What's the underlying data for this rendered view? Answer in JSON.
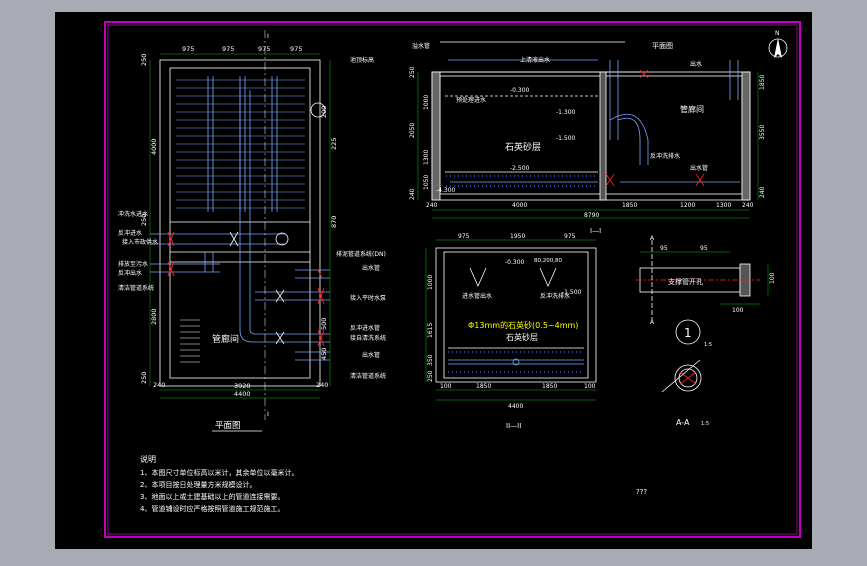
{
  "colors": {
    "canvas": "#000000",
    "outer_bg": "#a9abb4",
    "frame": "#c000c0",
    "lines": "#ffffff",
    "pipes": "#7aa6ff",
    "dim": "#00c000",
    "label": "#ffff00",
    "accent": "#ff2020",
    "sand": "#4d70ff"
  },
  "plan": {
    "title": "平面图",
    "top_dims": [
      "975",
      "975",
      "975",
      "975"
    ],
    "bottom_dims": [
      "240",
      "3920",
      "240"
    ],
    "overall_width": "4400",
    "left_dims": [
      "250",
      "4000",
      "250",
      "870",
      "2800",
      "250"
    ],
    "section_mark_top": "I",
    "section_mark_bottom": "I",
    "room_label": "管廊间",
    "left_labels": [
      "冲洗水进水",
      "接入市政供水",
      "反冲进水",
      "排放至污水",
      "反冲出水",
      "清洁管道系统"
    ],
    "right_labels": [
      "排泥管道系统(DN)",
      "出水管",
      "接入平时水泵",
      "反冲进水管",
      "接自清洗系统",
      "清洁管道系统",
      "出水管"
    ],
    "right_dims": [
      "200",
      "225",
      "500",
      "450"
    ],
    "elevation_tag": "池顶标高"
  },
  "section_1": {
    "title": "I—I",
    "top_label": "溢水管",
    "top_label_2": "平面图",
    "corridor_label": "管廊间",
    "sand_label": "石英砂层",
    "levels": [
      "-0.300",
      "-1.300",
      "-1.500",
      "-2.500",
      "-4.300"
    ],
    "labels": [
      "上清液出水",
      "预处理进水",
      "反冲洗排水",
      "出水",
      "出水管"
    ],
    "left_dims": [
      "250",
      "2050",
      "1000",
      "1300",
      "1050",
      "240"
    ],
    "right_dims": [
      "1850",
      "3550",
      "240"
    ],
    "bottom_dims": [
      "240",
      "4000",
      "1850",
      "1200",
      "1300",
      "240"
    ],
    "overall_width": "8790"
  },
  "section_2": {
    "title": "II—II",
    "top_dims": [
      "975",
      "1950",
      "975"
    ],
    "bottom_dims": [
      "100",
      "1850",
      "1850",
      "100"
    ],
    "overall_width": "4400",
    "left_dims": [
      "1000",
      "1615",
      "350",
      "250"
    ],
    "levels": [
      "-0.300",
      "-1.500"
    ],
    "labels": [
      "进水管出水",
      "反冲洗排水"
    ],
    "media_label": "Φ13mm的石英砂(0.5~4mm)",
    "sand_label": "石英砂层",
    "note_dim": "80,200,80"
  },
  "detail_a": {
    "label": "支撑管开孔",
    "dims": [
      "95",
      "95",
      "100",
      "100"
    ],
    "section_mark": "A",
    "section_label": "A-A",
    "scale": "1:5",
    "callout": "1",
    "callout_scale": "1:5"
  },
  "north": {
    "symbol": "N"
  },
  "notes": {
    "title": "说明",
    "items": [
      "1、本图尺寸单位标高以米计，其余单位以毫米计。",
      "2、本项目按日处理量方米规模设计。",
      "3、地面以上或土建基础以上的管道连接需要。",
      "4、管道铺设时应严格按照管道施工规范施工。"
    ]
  },
  "unknown_text": "???"
}
